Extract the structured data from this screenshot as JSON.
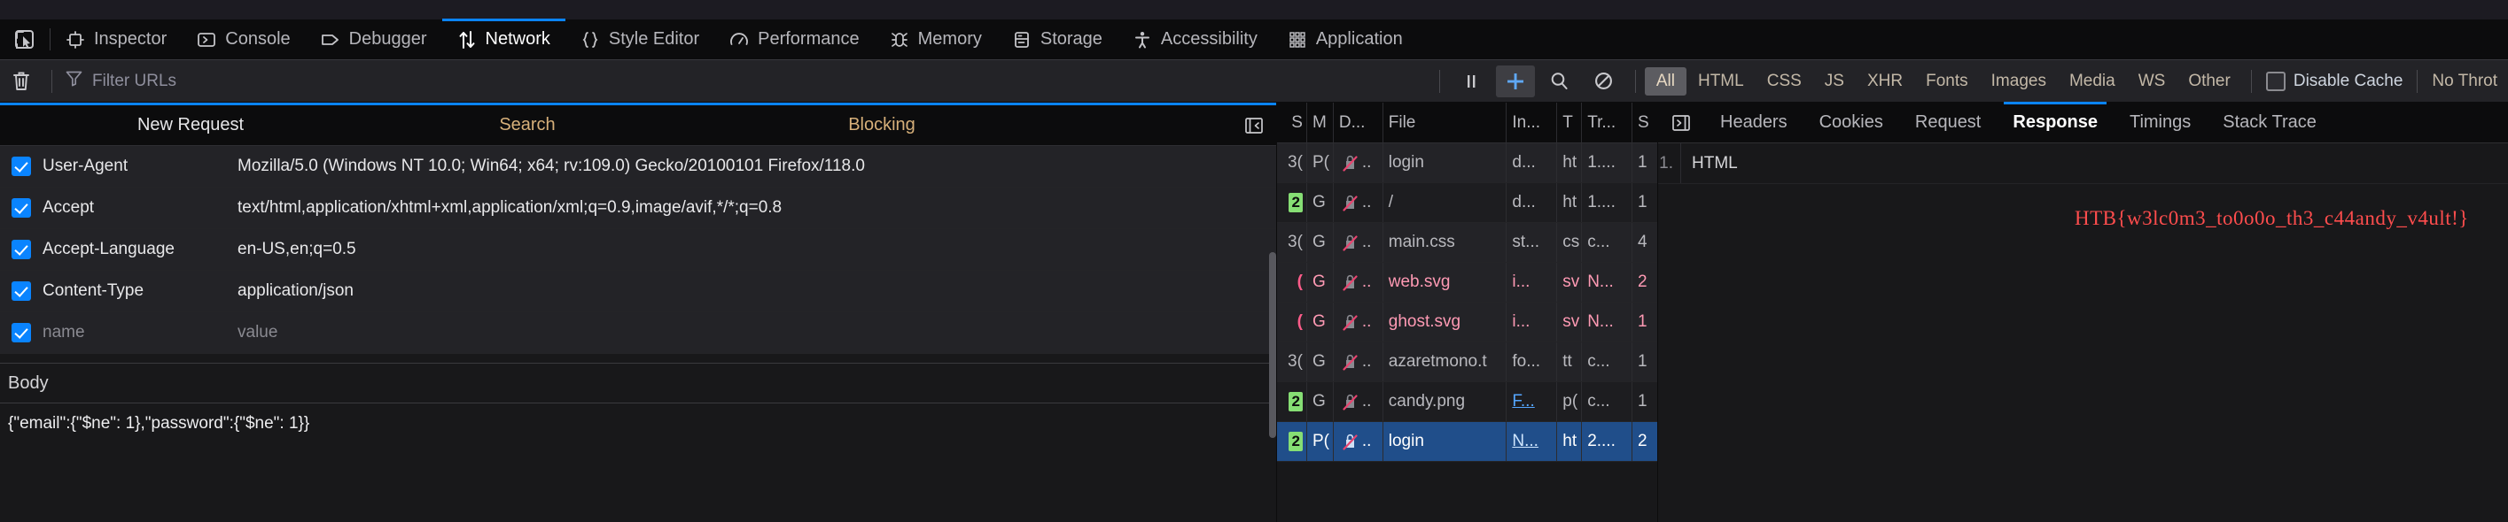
{
  "toolbox": {
    "picker_icon": "element-picker-icon",
    "tabs": [
      {
        "label": "Inspector",
        "icon": "inspector-icon",
        "active": false
      },
      {
        "label": "Console",
        "icon": "console-icon",
        "active": false
      },
      {
        "label": "Debugger",
        "icon": "debugger-icon",
        "active": false
      },
      {
        "label": "Network",
        "icon": "network-icon",
        "active": true
      },
      {
        "label": "Style Editor",
        "icon": "style-editor-icon",
        "active": false
      },
      {
        "label": "Performance",
        "icon": "performance-icon",
        "active": false
      },
      {
        "label": "Memory",
        "icon": "memory-icon",
        "active": false
      },
      {
        "label": "Storage",
        "icon": "storage-icon",
        "active": false
      },
      {
        "label": "Accessibility",
        "icon": "accessibility-icon",
        "active": false
      },
      {
        "label": "Application",
        "icon": "application-icon",
        "active": false
      }
    ]
  },
  "network_toolbar": {
    "clear_icon": "trash-icon",
    "filter_placeholder": "Filter URLs",
    "filter_value": "",
    "filter_icon": "funnel-icon",
    "buttons": [
      {
        "name": "pause-button",
        "icon": "pause-icon",
        "active": false
      },
      {
        "name": "new-request-button",
        "icon": "plus-icon",
        "active": true
      },
      {
        "name": "search-button",
        "icon": "search-icon",
        "active": false
      },
      {
        "name": "block-button",
        "icon": "block-icon",
        "active": false
      }
    ],
    "type_filters": [
      {
        "label": "All",
        "active": true
      },
      {
        "label": "HTML",
        "active": false
      },
      {
        "label": "CSS",
        "active": false
      },
      {
        "label": "JS",
        "active": false
      },
      {
        "label": "XHR",
        "active": false
      },
      {
        "label": "Fonts",
        "active": false
      },
      {
        "label": "Images",
        "active": false
      },
      {
        "label": "Media",
        "active": false
      },
      {
        "label": "WS",
        "active": false
      },
      {
        "label": "Other",
        "active": false
      }
    ],
    "disable_cache": {
      "label": "Disable Cache",
      "checked": false
    },
    "throttling": "No Throt"
  },
  "new_request": {
    "columns": {
      "new_request": "New Request",
      "search": "Search",
      "blocking": "Blocking"
    },
    "collapse_icon": "collapse-panel-icon",
    "headers": [
      {
        "checked": true,
        "name": "User-Agent",
        "value": "Mozilla/5.0 (Windows NT 10.0; Win64; x64; rv:109.0) Gecko/20100101 Firefox/118.0",
        "placeholder": false
      },
      {
        "checked": true,
        "name": "Accept",
        "value": "text/html,application/xhtml+xml,application/xml;q=0.9,image/avif,*/*;q=0.8",
        "placeholder": false
      },
      {
        "checked": true,
        "name": "Accept-Language",
        "value": "en-US,en;q=0.5",
        "placeholder": false
      },
      {
        "checked": true,
        "name": "Content-Type",
        "value": "application/json",
        "placeholder": false
      },
      {
        "checked": true,
        "name": "name",
        "value": "value",
        "placeholder": true
      }
    ],
    "body_label": "Body",
    "body_value": "{\"email\":{\"$ne\": 1},\"password\":{\"$ne\": 1}}"
  },
  "request_list": {
    "columns": [
      "S",
      "M",
      "D...",
      "File",
      "In...",
      "T",
      "Tr...",
      "S"
    ],
    "rows": [
      {
        "status": "3(",
        "status_kind": "3xx",
        "method": "P(",
        "domain_icon": "no-lock-icon",
        "domain": "..",
        "file": "login",
        "initiator": "d...",
        "initiator_link": false,
        "type": "ht",
        "transferred": "1....",
        "size": "1",
        "state": "normal"
      },
      {
        "status": "2",
        "status_kind": "2xx",
        "method": "G",
        "domain_icon": "no-lock-icon",
        "domain": "..",
        "file": "/",
        "initiator": "d...",
        "initiator_link": false,
        "type": "ht",
        "transferred": "1....",
        "size": "1",
        "state": "alt"
      },
      {
        "status": "3(",
        "status_kind": "3xx",
        "method": "G",
        "domain_icon": "no-lock-icon",
        "domain": "..",
        "file": "main.css",
        "initiator": "st...",
        "initiator_link": false,
        "type": "cs",
        "transferred": "c...",
        "size": "4",
        "state": "normal"
      },
      {
        "status": "(",
        "status_kind": "err",
        "method": "G",
        "domain_icon": "no-lock-icon",
        "domain": "..",
        "file": "web.svg",
        "initiator": "i...",
        "initiator_link": false,
        "type": "sv",
        "transferred": "N...",
        "size": "2",
        "state": "err"
      },
      {
        "status": "(",
        "status_kind": "err",
        "method": "G",
        "domain_icon": "no-lock-icon",
        "domain": "..",
        "file": "ghost.svg",
        "initiator": "i...",
        "initiator_link": false,
        "type": "sv",
        "transferred": "N...",
        "size": "1",
        "state": "err"
      },
      {
        "status": "3(",
        "status_kind": "3xx",
        "method": "G",
        "domain_icon": "no-lock-icon",
        "domain": "..",
        "file": "azaretmono.t",
        "initiator": "fo...",
        "initiator_link": false,
        "type": "tt",
        "transferred": "c...",
        "size": "1",
        "state": "normal"
      },
      {
        "status": "2",
        "status_kind": "2xx",
        "method": "G",
        "domain_icon": "no-lock-icon",
        "domain": "..",
        "file": "candy.png",
        "initiator": "F...",
        "initiator_link": true,
        "type": "p(",
        "transferred": "c...",
        "size": "1",
        "state": "alt"
      },
      {
        "status": "2",
        "status_kind": "2xx",
        "method": "P(",
        "domain_icon": "no-lock-icon",
        "domain": "..",
        "file": "login",
        "initiator": "N...",
        "initiator_link": true,
        "type": "ht",
        "transferred": "2....",
        "size": "2",
        "state": "sel"
      }
    ]
  },
  "details": {
    "expand_icon": "expand-panel-icon",
    "tabs": [
      {
        "label": "Headers",
        "active": false
      },
      {
        "label": "Cookies",
        "active": false
      },
      {
        "label": "Request",
        "active": false
      },
      {
        "label": "Response",
        "active": true
      },
      {
        "label": "Timings",
        "active": false
      },
      {
        "label": "Stack Trace",
        "active": false
      }
    ],
    "response_lines": [
      {
        "number": "1.",
        "text": "HTML"
      }
    ],
    "rendered_flag": "HTB{w3lc0m3_to0o0o_th3_c44andy_v4ult!}"
  }
}
